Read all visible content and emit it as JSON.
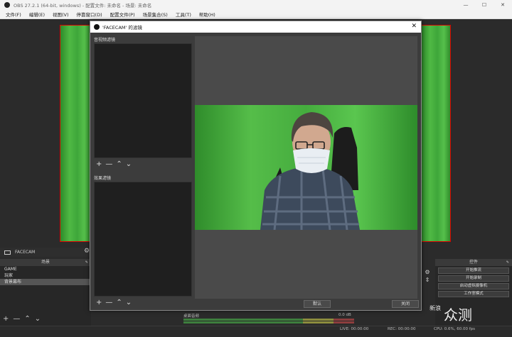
{
  "obs": {
    "window_title": "OBS 27.2.1 (64-bit, windows) - 配置文件: 未命名 - 场景: 未命名",
    "controls": {
      "minimize": "—",
      "maximize": "☐",
      "close": "✕"
    }
  },
  "menu": [
    "文件(F)",
    "编辑(E)",
    "视图(V)",
    "停靠窗口(D)",
    "配置文件(P)",
    "场景集合(S)",
    "工具(T)",
    "帮助(H)"
  ],
  "source_bar": {
    "label": "FACECAM"
  },
  "scenes": {
    "header": "场景",
    "items": [
      "GAME",
      "玩家",
      "背景幕布"
    ],
    "selected": "背景幕布",
    "toolbar": [
      "+",
      "—",
      "⌃",
      "⌄"
    ]
  },
  "mixer": {
    "label": "桌面音频",
    "db": "0.0 dB"
  },
  "controls_dock": {
    "header": "控件",
    "buttons": [
      "开始推流",
      "开始录制",
      "启动虚拟摄像机",
      "工作室模式"
    ]
  },
  "status": {
    "live": "LIVE: 00:00:00",
    "rec": "REC: 00:00:00",
    "cpu": "CPU: 0.6%, 60.00 fps"
  },
  "dialog": {
    "title": "'FACECAM' 的滤镜",
    "close": "✕",
    "av_filters_label": "音视频滤镜",
    "effect_filters_label": "效果滤镜",
    "toolbar": [
      "+",
      "—",
      "⌃",
      "⌄"
    ],
    "default_button": "默认",
    "close_button": "关闭"
  },
  "watermark": {
    "text": "众测",
    "box": "新浪"
  },
  "colors": {
    "chroma_green": "#4fb944",
    "selection_red": "#dd0000",
    "dialog_bg": "#3c3c3c"
  }
}
